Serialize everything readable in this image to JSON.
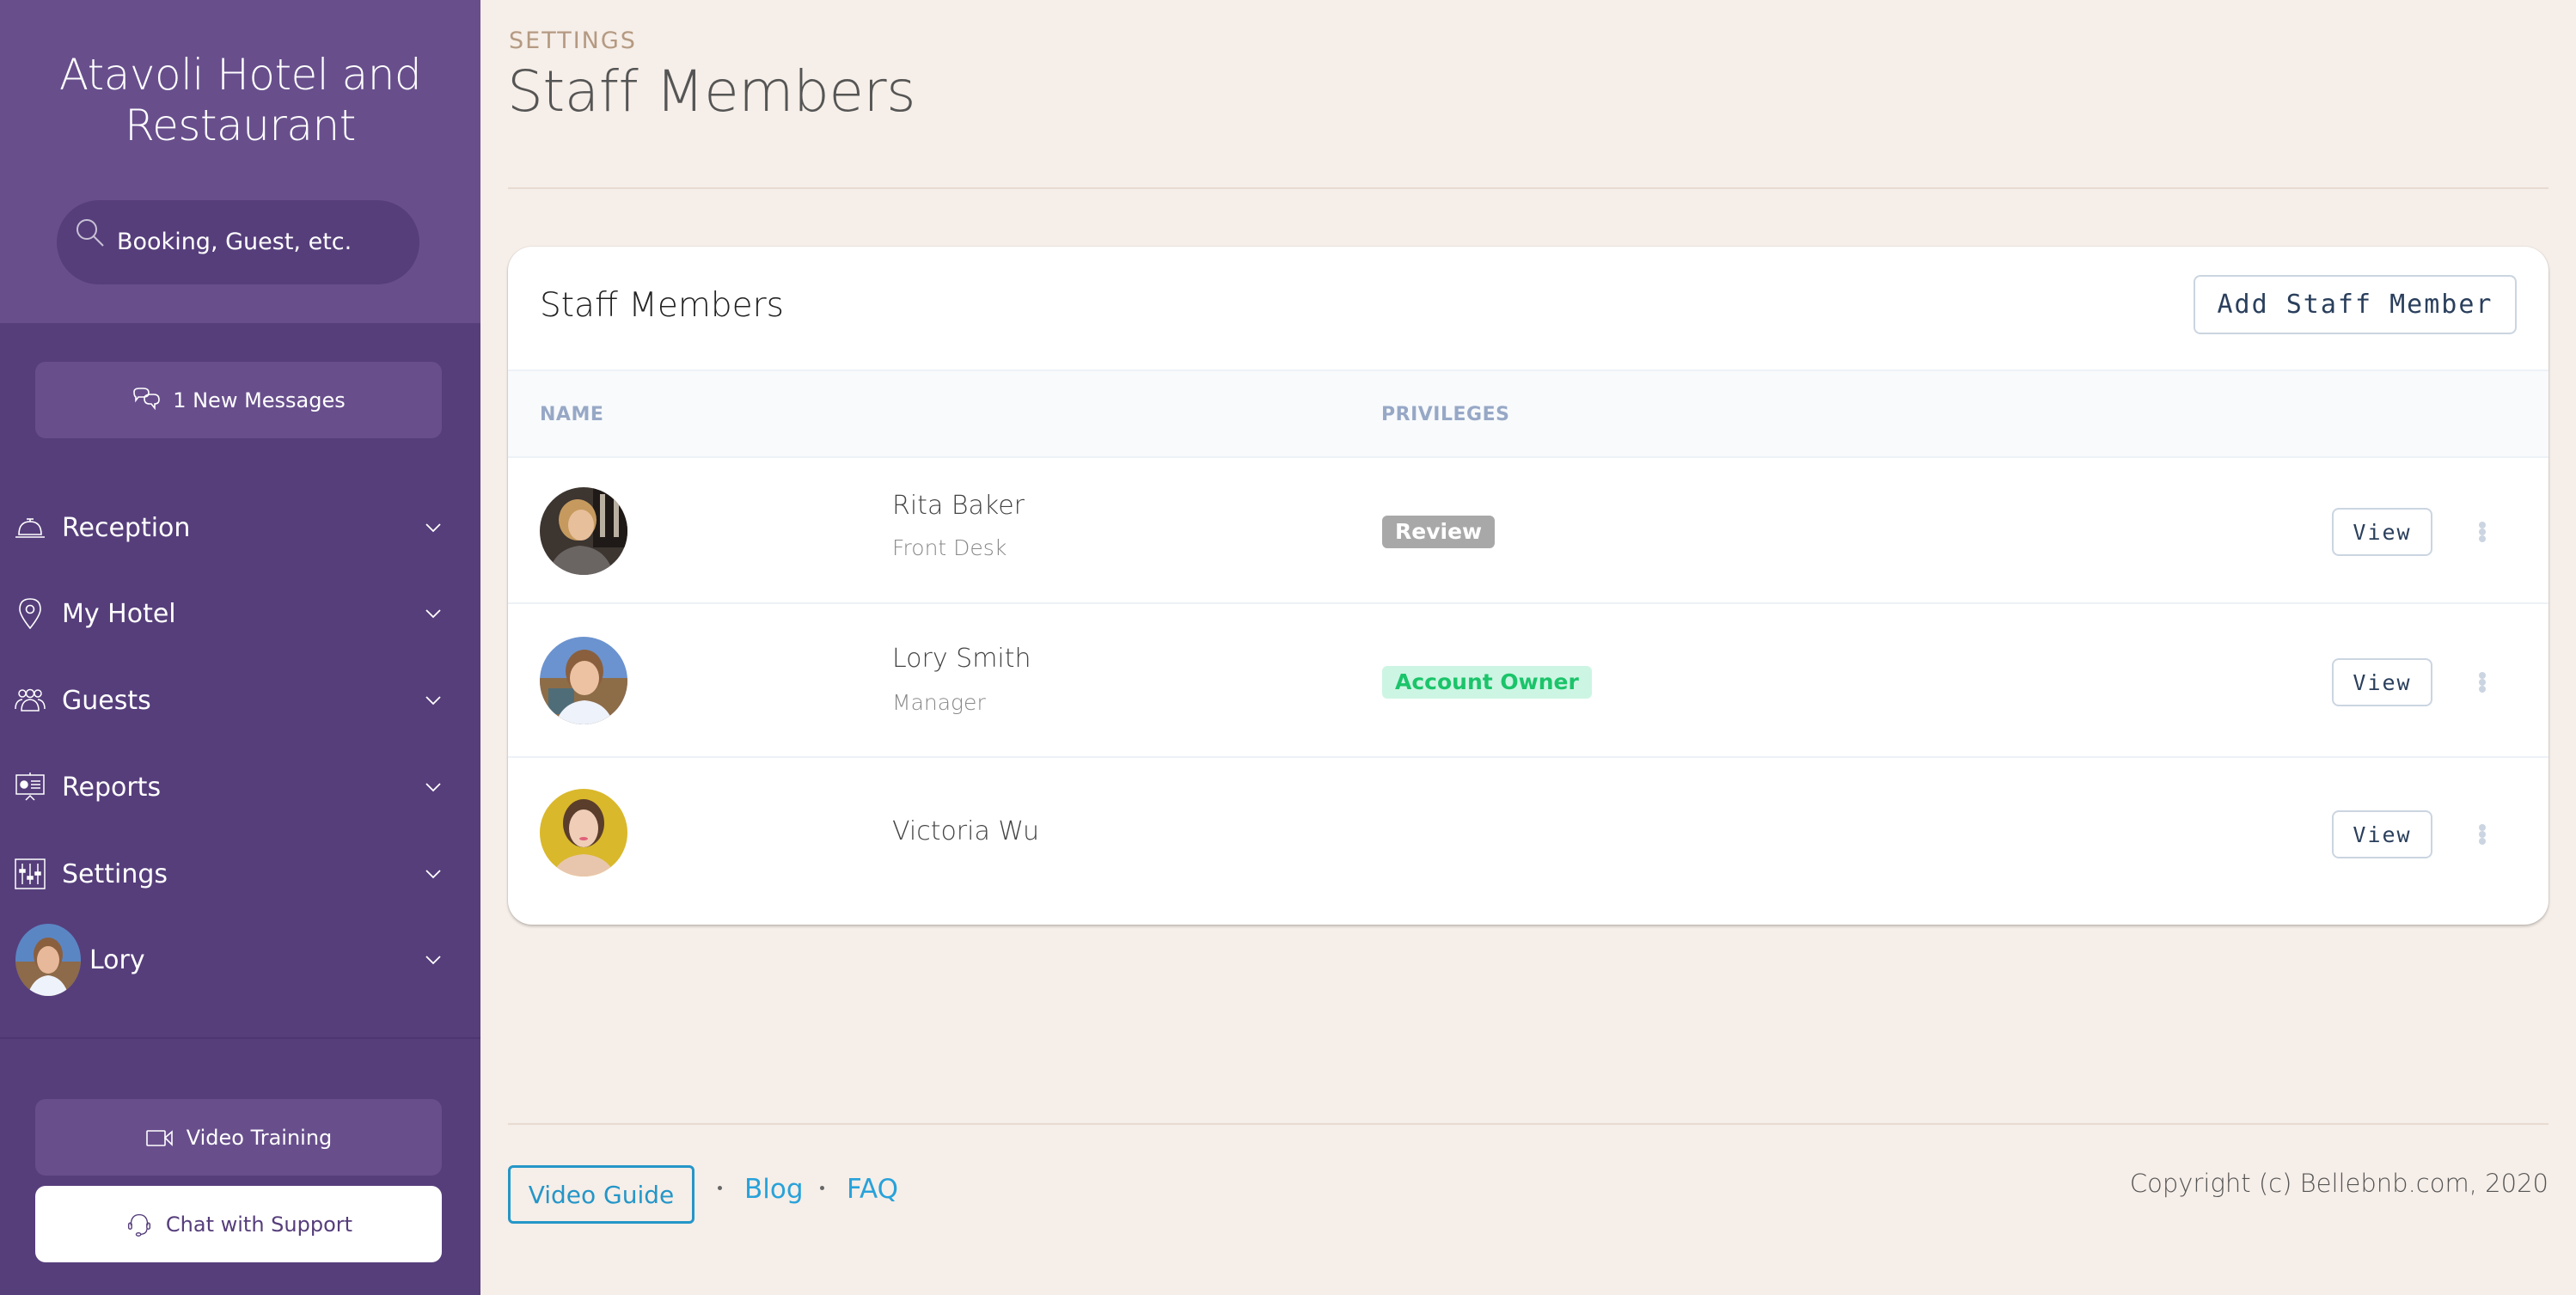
{
  "sidebar": {
    "brand_line1": "Atavoli Hotel and",
    "brand_line2": "Restaurant",
    "search": {
      "placeholder": "Booking, Guest, etc.",
      "value": "",
      "icon": "search-icon"
    },
    "messages_button": {
      "label": "1 New Messages",
      "icon": "chat-bubbles-icon"
    },
    "nav": [
      {
        "label": "Reception",
        "icon": "service-bell-icon"
      },
      {
        "label": "My Hotel",
        "icon": "map-pin-icon"
      },
      {
        "label": "Guests",
        "icon": "users-icon"
      },
      {
        "label": "Reports",
        "icon": "presentation-icon"
      },
      {
        "label": "Settings",
        "icon": "sliders-icon"
      }
    ],
    "user": {
      "label": "Lory",
      "icon": "avatar"
    },
    "video_training": {
      "label": "Video Training",
      "icon": "video-camera-icon"
    },
    "chat_support": {
      "label": "Chat with Support",
      "icon": "headset-icon"
    }
  },
  "header": {
    "breadcrumb": "SETTINGS",
    "title": "Staff Members"
  },
  "card": {
    "title": "Staff Members",
    "add_button": "Add Staff Member",
    "columns": [
      "NAME",
      "PRIVILEGES"
    ],
    "rows": [
      {
        "name": "Rita Baker",
        "role": "Front Desk",
        "privilege": "Review",
        "privilege_style": "review",
        "action": "View"
      },
      {
        "name": "Lory Smith",
        "role": "Manager",
        "privilege": "Account Owner",
        "privilege_style": "owner",
        "action": "View"
      },
      {
        "name": "Victoria Wu",
        "role": "",
        "privilege": "",
        "privilege_style": "",
        "action": "View"
      }
    ]
  },
  "footer": {
    "video_guide": "Video Guide",
    "links": [
      "Blog",
      "FAQ"
    ],
    "copyright": "Copyright (c) Bellebnb.com, 2020"
  },
  "colors": {
    "sidebar_bg": "#563e7b",
    "sidebar_header_bg": "#684f8c",
    "page_bg": "#f6eee8",
    "link": "#28a2da",
    "badge_review_bg": "#a8a8a8",
    "badge_owner_bg": "#cdf5e3",
    "badge_owner_text": "#1bc46a"
  }
}
